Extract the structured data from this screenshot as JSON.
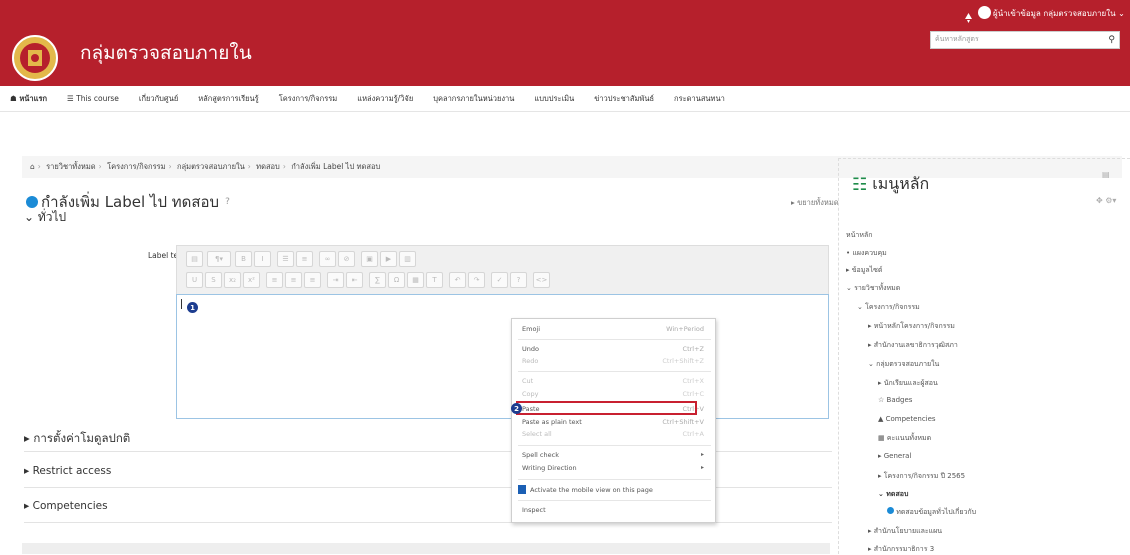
{
  "header": {
    "user_name": "ผู้นำเข้าข้อมูล กลุ่มตรวจสอบภายใน ⌄",
    "site_title": "กลุ่มตรวจสอบภายใน",
    "search_placeholder": "ค้นหาหลักสูตร"
  },
  "nav": [
    "หน้าแรก",
    "This course",
    "เกี่ยวกับศูนย์",
    "หลักสูตรการเรียนรู้",
    "โครงการ/กิจกรรม",
    "แหล่งความรู้/วิจัย",
    "บุคลากรภายในหน่วยงาน",
    "แบบประเมิน",
    "ข่าวประชาสัมพันธ์",
    "กระดานสนทนา"
  ],
  "breadcrumb": [
    "รายวิชาทั้งหมด",
    "โครงการ/กิจกรรม",
    "กลุ่มตรวจสอบภายใน",
    "ทดสอบ",
    "กำลังเพิ่ม Label ไป ทดสอบ"
  ],
  "page": {
    "title": "กำลังเพิ่ม Label ไป ทดสอบ",
    "help_icon": "?",
    "expand_all": "▸ ขยายทั้งหมด",
    "section_general": "⌄ ทั่วไป",
    "label_text": "Label text",
    "sections": [
      "▸ การตั้งค่าโมดูลปกติ",
      "▸ Restrict access",
      "▸ Competencies"
    ]
  },
  "steps": {
    "one": "1",
    "two": "2"
  },
  "context_menu": [
    {
      "label": "Emoji",
      "shortcut": "Win+Period",
      "disabled": false
    },
    {
      "label": "Undo",
      "shortcut": "Ctrl+Z",
      "disabled": false
    },
    {
      "label": "Redo",
      "shortcut": "Ctrl+Shift+Z",
      "disabled": true
    },
    {
      "label": "Cut",
      "shortcut": "Ctrl+X",
      "disabled": true
    },
    {
      "label": "Copy",
      "shortcut": "Ctrl+C",
      "disabled": true
    },
    {
      "label": "Paste",
      "shortcut": "Ctrl+V",
      "disabled": false
    },
    {
      "label": "Paste as plain text",
      "shortcut": "Ctrl+Shift+V",
      "disabled": false
    },
    {
      "label": "Select all",
      "shortcut": "Ctrl+A",
      "disabled": true
    },
    {
      "label": "Spell check",
      "shortcut": "",
      "disabled": false,
      "submenu": true
    },
    {
      "label": "Writing Direction",
      "shortcut": "",
      "disabled": false,
      "submenu": true
    },
    {
      "label": "Activate the mobile view on this page",
      "shortcut": "",
      "disabled": false
    },
    {
      "label": "Inspect",
      "shortcut": "",
      "disabled": false
    }
  ],
  "sidebar": {
    "title": "เมนูหลัก",
    "items": [
      "หน้าหลัก",
      "• แผงควบคุม",
      "▸ ข้อมูลไซต์",
      "⌄ รายวิชาทั้งหมด",
      "⌄ โครงการ/กิจกรรม",
      "▸ หน้าหลักโครงการ/กิจกรรม",
      "▸ สำนักงานเลขาธิการวุฒิสภา",
      "⌄ กลุ่มตรวจสอบภายใน",
      "▸ นักเรียนและผู้สอน",
      "Badges",
      "Competencies",
      "คะแนนทั้งหมด",
      "▸ General",
      "▸ โครงการ/กิจกรรม ปี 2565",
      "⌄ ทดสอบ",
      "ทดสอบข้อมูลทั่วไปเกี่ยวกับ",
      "▸ สำนักนโยบายและแผน",
      "▸ สำนักกรรมาธิการ 3"
    ]
  },
  "colors": {
    "brand": "#b6202c",
    "accent": "#1b8bd6",
    "step": "#1d3d8f"
  }
}
